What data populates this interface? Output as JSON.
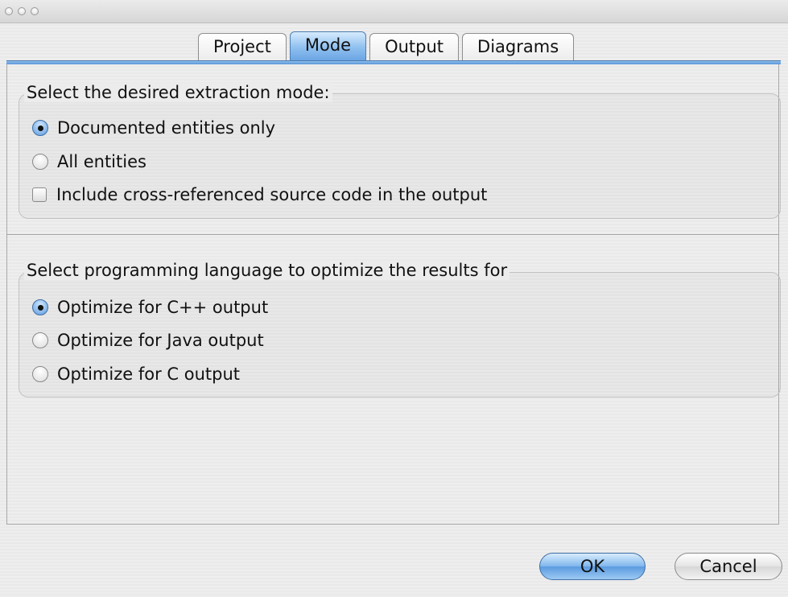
{
  "tabs": [
    {
      "label": "Project",
      "selected": false
    },
    {
      "label": "Mode",
      "selected": true
    },
    {
      "label": "Output",
      "selected": false
    },
    {
      "label": "Diagrams",
      "selected": false
    }
  ],
  "extraction": {
    "title": "Select the desired extraction mode:",
    "options": [
      {
        "label": "Documented entities only",
        "selected": true
      },
      {
        "label": "All entities",
        "selected": false
      }
    ],
    "checkbox": {
      "label": "Include cross-referenced source code in the output",
      "checked": false
    }
  },
  "language": {
    "title": "Select programming language to optimize the results for",
    "options": [
      {
        "label": "Optimize for C++ output",
        "selected": true
      },
      {
        "label": "Optimize for Java output",
        "selected": false
      },
      {
        "label": "Optimize for C output",
        "selected": false
      }
    ]
  },
  "buttons": {
    "ok": "OK",
    "cancel": "Cancel"
  },
  "colors": {
    "accent": "#6aa5e3",
    "window_bg": "#ececec"
  }
}
